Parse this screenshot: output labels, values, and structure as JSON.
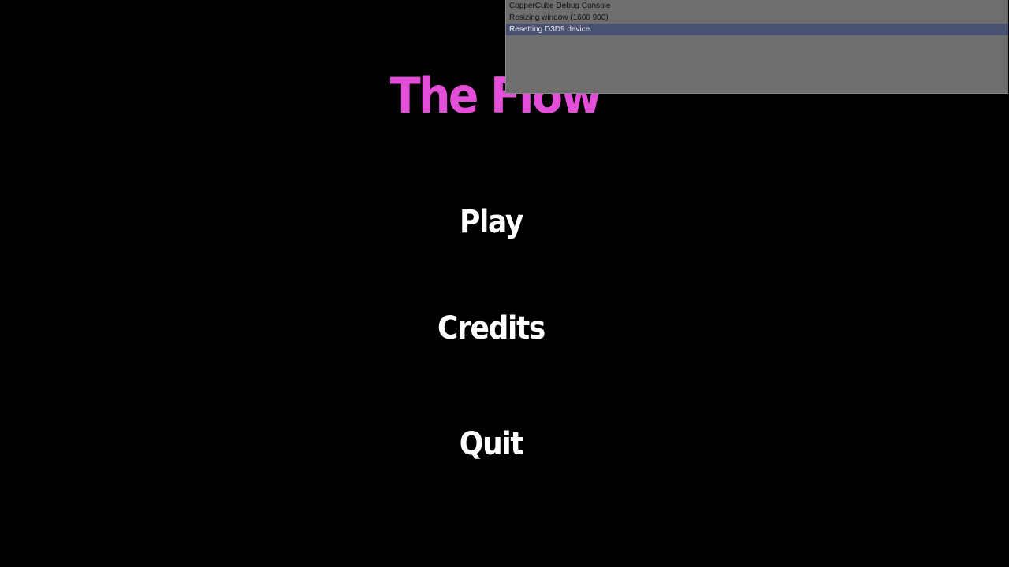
{
  "game": {
    "title": "The Flow",
    "title_color": "#e44fd9",
    "menu_color": "#ffffff",
    "menu": {
      "play": "Play",
      "credits": "Credits",
      "quit": "Quit"
    }
  },
  "debug_console": {
    "lines": [
      "CopperCube Debug Console",
      "Resizing window (1600 900)",
      "Resetting D3D9 device."
    ],
    "selected_line": 2,
    "background_color": "#6e6e6e",
    "selected_color": "#4a5272"
  }
}
